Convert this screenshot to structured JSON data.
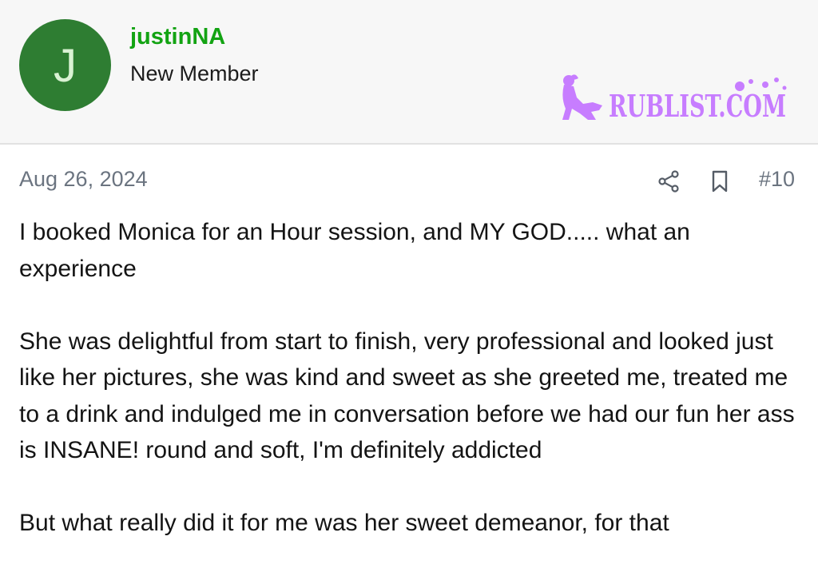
{
  "author": {
    "avatar_letter": "J",
    "avatar_color": "#2e7d32",
    "username": "justinNA",
    "username_color": "#13a313",
    "title": "New Member"
  },
  "watermark": {
    "text": "RUBLIST.COM",
    "color": "#c77dff"
  },
  "post": {
    "date": "Aug 26, 2024",
    "number": "#10",
    "share_icon": "share-icon",
    "bookmark_icon": "bookmark-icon",
    "paragraphs": [
      "I booked Monica for an Hour session, and MY GOD..... what an experience",
      "She was delightful from start to finish, very professional and looked just like her pictures, she was kind and sweet as she greeted me, treated me to a drink and indulged me in conversation before we had our fun her ass is INSANE! round and soft, I'm definitely addicted",
      "But what really did it for me was her sweet demeanor, for that"
    ]
  }
}
